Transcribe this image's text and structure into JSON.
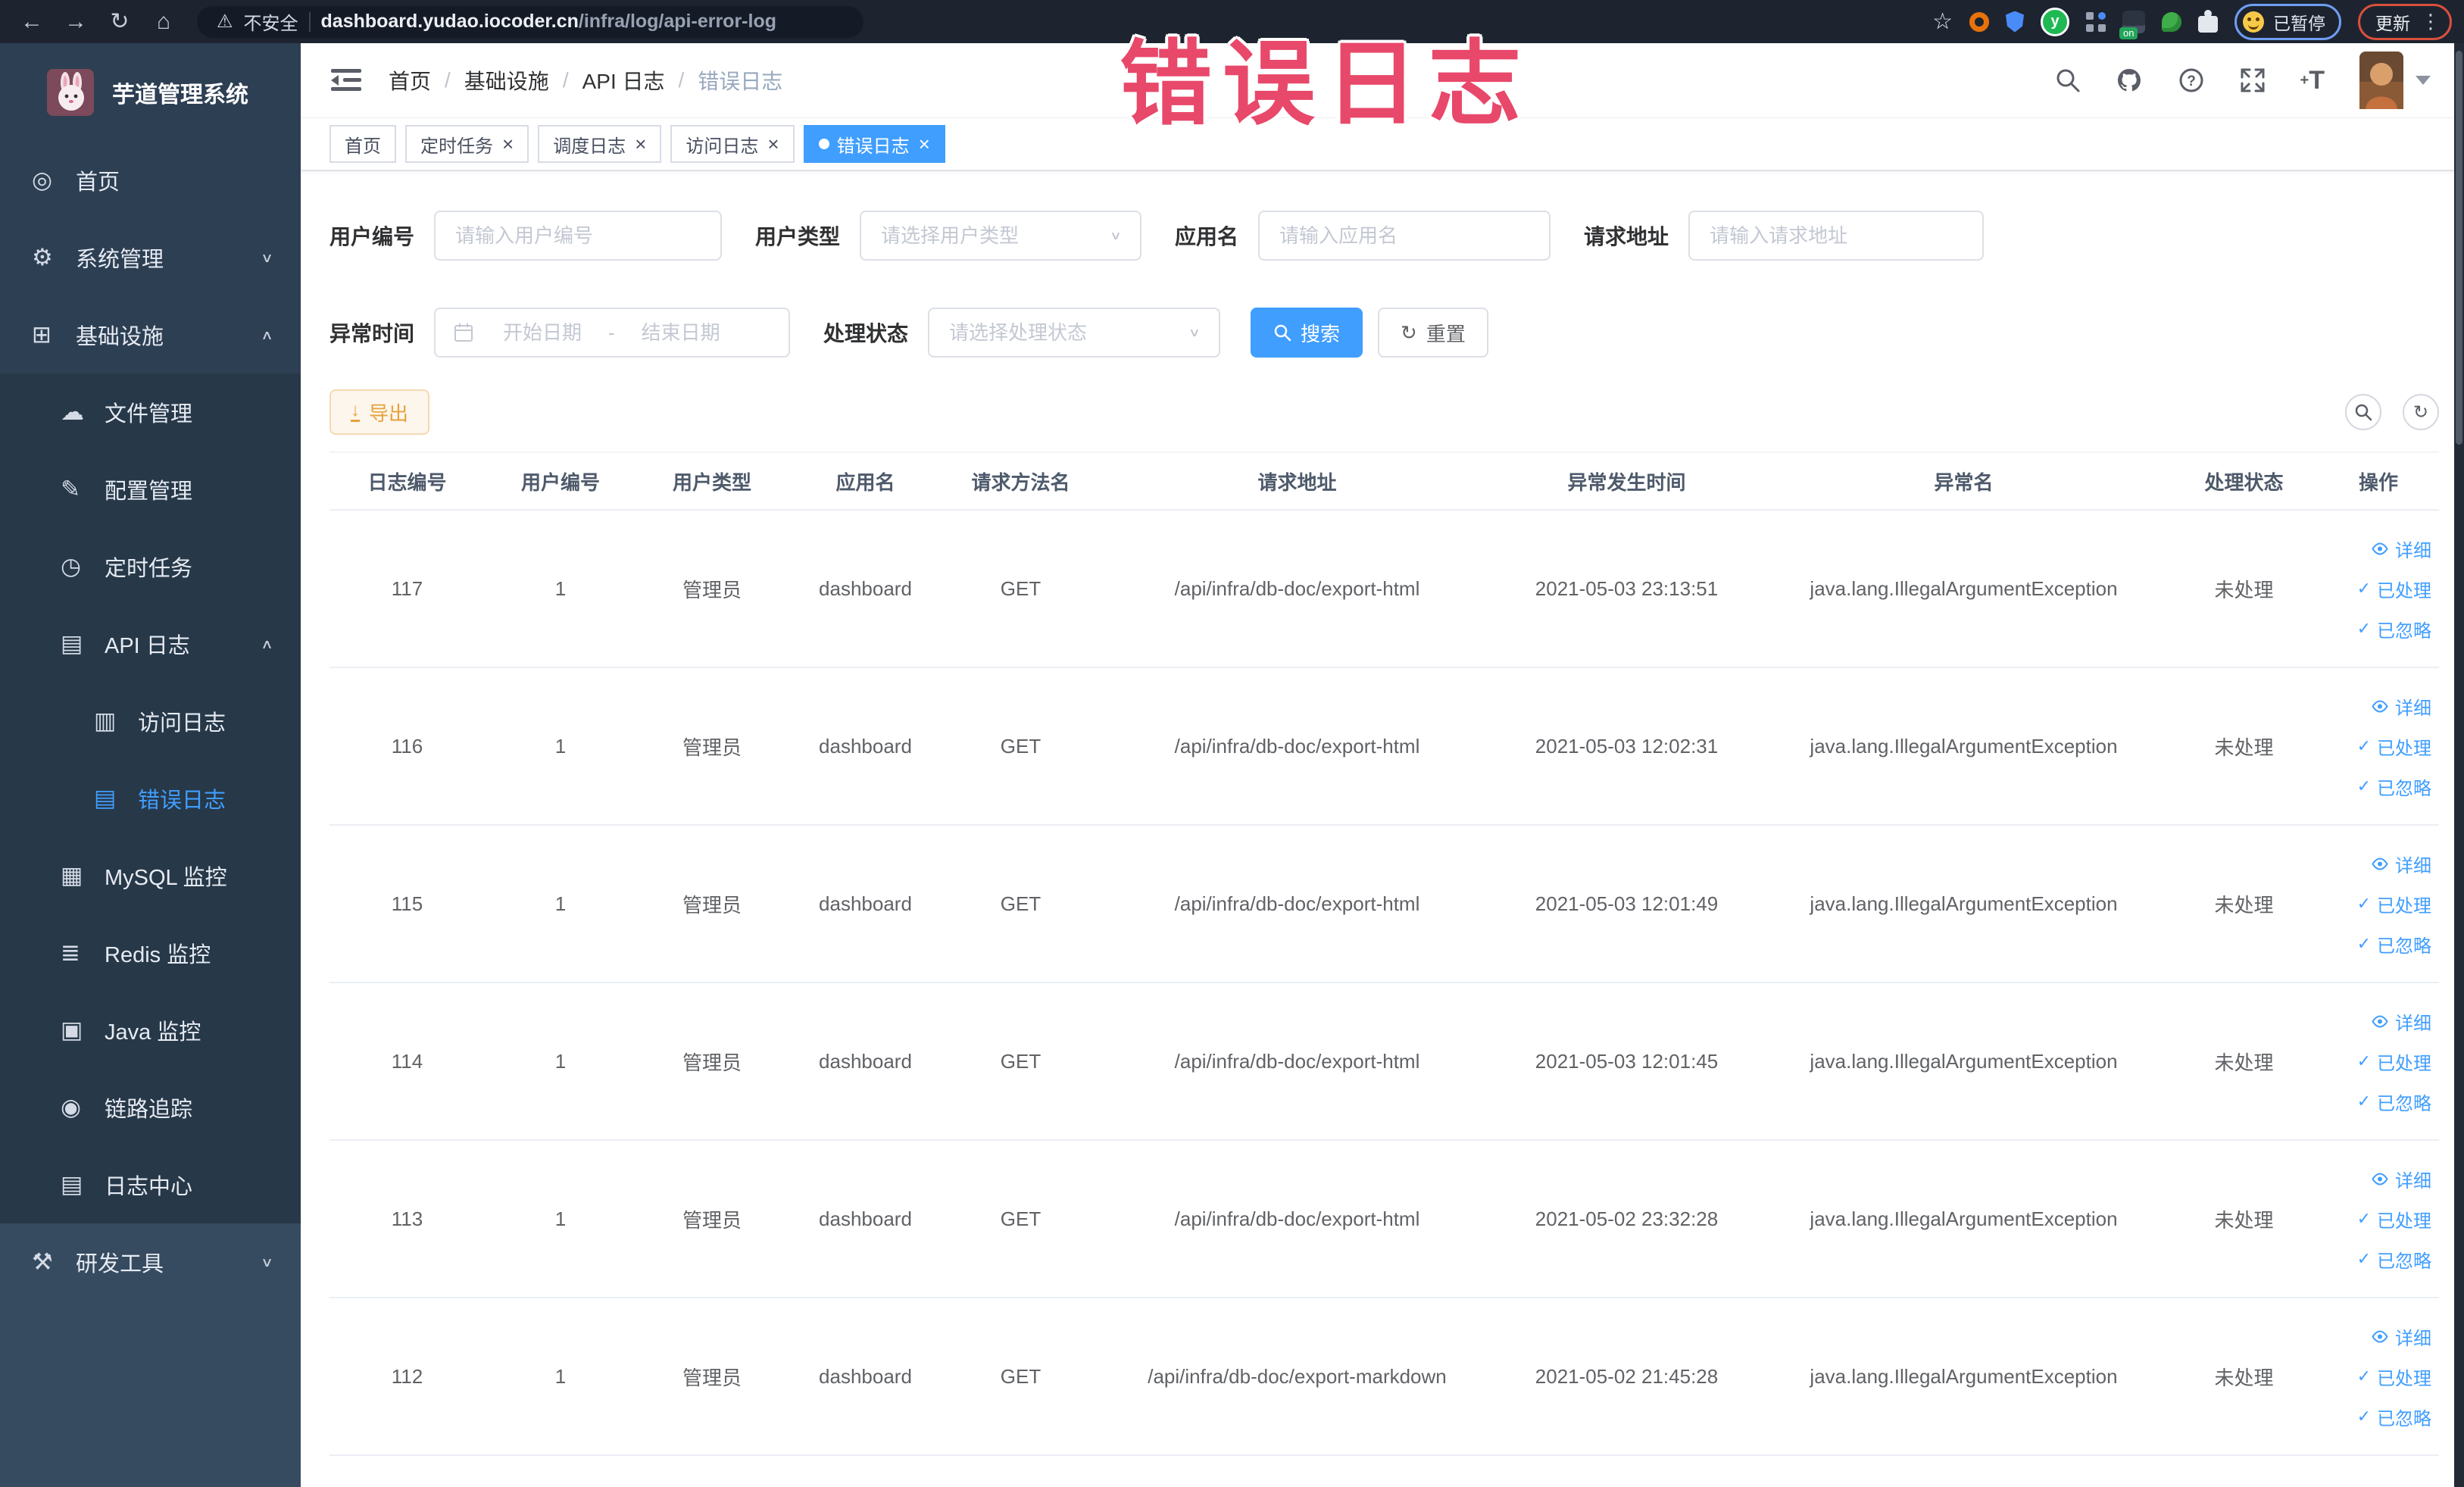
{
  "watermark_text": "错误日志",
  "browser": {
    "security_label": "不安全",
    "url_domain": "dashboard.yudao.iocoder.cn",
    "url_path": "/infra/log/api-error-log",
    "extension_on_badge": "on",
    "paused_label": "已暂停",
    "update_label": "更新"
  },
  "sidebar": {
    "title": "芋道管理系统",
    "items": [
      {
        "label": "首页",
        "icon": "dashboard-icon",
        "level": 1,
        "arrow": "",
        "zone": "top",
        "active": false
      },
      {
        "label": "系统管理",
        "icon": "gear-icon",
        "level": 1,
        "arrow": "down",
        "zone": "top",
        "active": false
      },
      {
        "label": "基础设施",
        "icon": "infrastructure-icon",
        "level": 1,
        "arrow": "up",
        "zone": "top",
        "active": false
      },
      {
        "label": "文件管理",
        "icon": "file-icon",
        "level": 2,
        "arrow": "",
        "zone": "sub",
        "active": false
      },
      {
        "label": "配置管理",
        "icon": "config-icon",
        "level": 2,
        "arrow": "",
        "zone": "sub",
        "active": false
      },
      {
        "label": "定时任务",
        "icon": "timer-icon",
        "level": 2,
        "arrow": "",
        "zone": "sub",
        "active": false
      },
      {
        "label": "API 日志",
        "icon": "api-log-icon",
        "level": 2,
        "arrow": "up",
        "zone": "sub",
        "active": false
      },
      {
        "label": "访问日志",
        "icon": "access-log-icon",
        "level": 3,
        "arrow": "",
        "zone": "sub",
        "active": false
      },
      {
        "label": "错误日志",
        "icon": "error-log-icon",
        "level": 3,
        "arrow": "",
        "zone": "sub",
        "active": true
      },
      {
        "label": "MySQL 监控",
        "icon": "mysql-icon",
        "level": 2,
        "arrow": "",
        "zone": "sub",
        "active": false
      },
      {
        "label": "Redis 监控",
        "icon": "redis-icon",
        "level": 2,
        "arrow": "",
        "zone": "sub",
        "active": false
      },
      {
        "label": "Java 监控",
        "icon": "java-icon",
        "level": 2,
        "arrow": "",
        "zone": "sub",
        "active": false
      },
      {
        "label": "链路追踪",
        "icon": "trace-icon",
        "level": 2,
        "arrow": "",
        "zone": "sub",
        "active": false
      },
      {
        "label": "日志中心",
        "icon": "log-center-icon",
        "level": 2,
        "arrow": "",
        "zone": "sub",
        "active": false
      },
      {
        "label": "研发工具",
        "icon": "devtools-icon",
        "level": 1,
        "arrow": "down",
        "zone": "bottom",
        "active": false
      }
    ]
  },
  "header": {
    "breadcrumb": [
      {
        "label": "首页",
        "last": false
      },
      {
        "label": "基础设施",
        "last": false
      },
      {
        "label": "API 日志",
        "last": false
      },
      {
        "label": "错误日志",
        "last": true
      }
    ]
  },
  "tabs": [
    {
      "label": "首页",
      "closable": false,
      "active": false
    },
    {
      "label": "定时任务",
      "closable": true,
      "active": false
    },
    {
      "label": "调度日志",
      "closable": true,
      "active": false
    },
    {
      "label": "访问日志",
      "closable": true,
      "active": false
    },
    {
      "label": "错误日志",
      "closable": true,
      "active": true
    }
  ],
  "filters": {
    "user_id": {
      "label": "用户编号",
      "placeholder": "请输入用户编号"
    },
    "user_type": {
      "label": "用户类型",
      "placeholder": "请选择用户类型"
    },
    "app_name": {
      "label": "应用名",
      "placeholder": "请输入应用名"
    },
    "request_url": {
      "label": "请求地址",
      "placeholder": "请输入请求地址"
    },
    "exception_time": {
      "label": "异常时间",
      "start_placeholder": "开始日期",
      "separator": "-",
      "end_placeholder": "结束日期"
    },
    "process_status": {
      "label": "处理状态",
      "placeholder": "请选择处理状态"
    },
    "search_label": "搜索",
    "reset_label": "重置"
  },
  "toolbar": {
    "export_label": "导出"
  },
  "table": {
    "columns": [
      "日志编号",
      "用户编号",
      "用户类型",
      "应用名",
      "请求方法名",
      "请求地址",
      "异常发生时间",
      "异常名",
      "处理状态",
      "操作"
    ],
    "actions": [
      "详细",
      "已处理",
      "已忽略"
    ],
    "rows": [
      {
        "log_id": "117",
        "user_id": "1",
        "user_type": "管理员",
        "app_name": "dashboard",
        "method": "GET",
        "url": "/api/infra/db-doc/export-html",
        "time": "2021-05-03 23:13:51",
        "exception": "java.lang.IllegalArgumentException",
        "status": "未处理"
      },
      {
        "log_id": "116",
        "user_id": "1",
        "user_type": "管理员",
        "app_name": "dashboard",
        "method": "GET",
        "url": "/api/infra/db-doc/export-html",
        "time": "2021-05-03 12:02:31",
        "exception": "java.lang.IllegalArgumentException",
        "status": "未处理"
      },
      {
        "log_id": "115",
        "user_id": "1",
        "user_type": "管理员",
        "app_name": "dashboard",
        "method": "GET",
        "url": "/api/infra/db-doc/export-html",
        "time": "2021-05-03 12:01:49",
        "exception": "java.lang.IllegalArgumentException",
        "status": "未处理"
      },
      {
        "log_id": "114",
        "user_id": "1",
        "user_type": "管理员",
        "app_name": "dashboard",
        "method": "GET",
        "url": "/api/infra/db-doc/export-html",
        "time": "2021-05-03 12:01:45",
        "exception": "java.lang.IllegalArgumentException",
        "status": "未处理"
      },
      {
        "log_id": "113",
        "user_id": "1",
        "user_type": "管理员",
        "app_name": "dashboard",
        "method": "GET",
        "url": "/api/infra/db-doc/export-html",
        "time": "2021-05-02 23:32:28",
        "exception": "java.lang.IllegalArgumentException",
        "status": "未处理"
      },
      {
        "log_id": "112",
        "user_id": "1",
        "user_type": "管理员",
        "app_name": "dashboard",
        "method": "GET",
        "url": "/api/infra/db-doc/export-markdown",
        "time": "2021-05-02 21:45:28",
        "exception": "java.lang.IllegalArgumentException",
        "status": "未处理"
      }
    ]
  },
  "colors": {
    "primary": "#409eff",
    "warning": "#e6a23c",
    "watermark": "#e8486a",
    "sidebar_bg": "#2d3f53",
    "active_tab_bg": "#409eff"
  }
}
